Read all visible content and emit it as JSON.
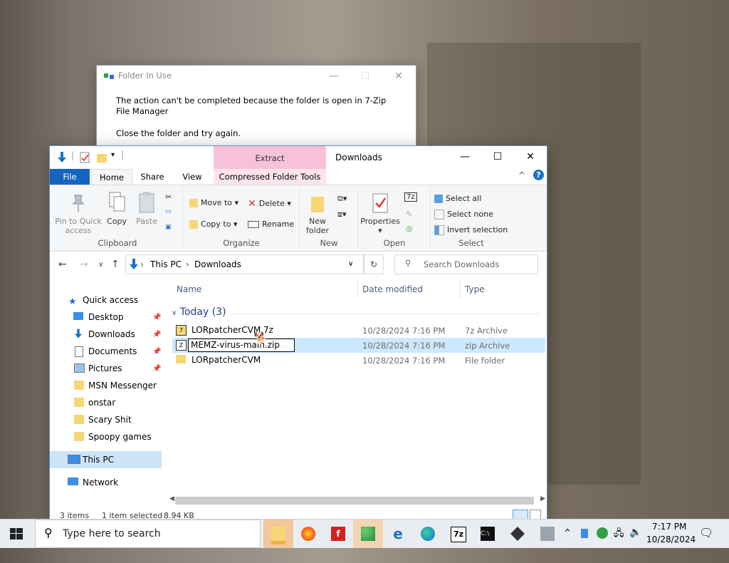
{
  "dialog": {
    "title": "Folder In Use",
    "message": "The action can't be completed because the folder is open in 7-Zip File Manager",
    "hint": "Close the folder and try again.",
    "partial_text": "MEMZ-virus-main.zip"
  },
  "window": {
    "title": "Downloads",
    "context_tab": "Extract",
    "tabs": [
      "File",
      "Home",
      "Share",
      "View",
      "Compressed Folder Tools"
    ],
    "ribbon": {
      "clipboard": {
        "label": "Clipboard",
        "pin": "Pin to Quick access",
        "copy": "Copy",
        "paste": "Paste"
      },
      "organize": {
        "label": "Organize",
        "move_to": "Move to",
        "copy_to": "Copy to",
        "delete": "Delete",
        "rename": "Rename"
      },
      "new": {
        "label": "New",
        "new_folder": "New folder"
      },
      "open": {
        "label": "Open",
        "properties": "Properties"
      },
      "select": {
        "label": "Select",
        "select_all": "Select all",
        "select_none": "Select none",
        "invert": "Invert selection"
      }
    },
    "address": {
      "crumbs": [
        "This PC",
        "Downloads"
      ]
    },
    "search_placeholder": "Search Downloads",
    "sidebar": {
      "quick_access": "Quick access",
      "items": [
        {
          "label": "Desktop",
          "pinned": true,
          "icon": "desktop-icon"
        },
        {
          "label": "Downloads",
          "pinned": true,
          "icon": "downloads-icon"
        },
        {
          "label": "Documents",
          "pinned": true,
          "icon": "documents-icon"
        },
        {
          "label": "Pictures",
          "pinned": true,
          "icon": "pictures-icon"
        },
        {
          "label": "MSN Messenger",
          "pinned": false,
          "icon": "folder-icon"
        },
        {
          "label": "onstar",
          "pinned": false,
          "icon": "folder-icon"
        },
        {
          "label": "Scary Shit",
          "pinned": false,
          "icon": "folder-icon"
        },
        {
          "label": "Spoopy games",
          "pinned": false,
          "icon": "folder-icon"
        }
      ],
      "this_pc": "This PC",
      "network": "Network"
    },
    "columns": {
      "name": "Name",
      "date": "Date modified",
      "type": "Type"
    },
    "group": "Today (3)",
    "files": [
      {
        "name": "LORpatcherCVM.7z",
        "date": "10/28/2024 7:16 PM",
        "type": "7z Archive",
        "selected": false
      },
      {
        "name": "MEMZ-virus-main.zip",
        "date": "10/28/2024 7:16 PM",
        "type": "zip Archive",
        "selected": true,
        "renaming": true
      },
      {
        "name": "LORpatcherCVM",
        "date": "10/28/2024 7:16 PM",
        "type": "File folder",
        "selected": false
      }
    ],
    "status": {
      "count": "3 items",
      "selection": "1 item selected",
      "size": "8.94 KB"
    }
  },
  "taskbar": {
    "search_placeholder": "Type here to search",
    "time": "7:17 PM",
    "date": "10/28/2024"
  },
  "colors": {
    "accent": "#1565c0",
    "extract_tab": "#f7c1d9",
    "selection": "#cce8ff"
  }
}
